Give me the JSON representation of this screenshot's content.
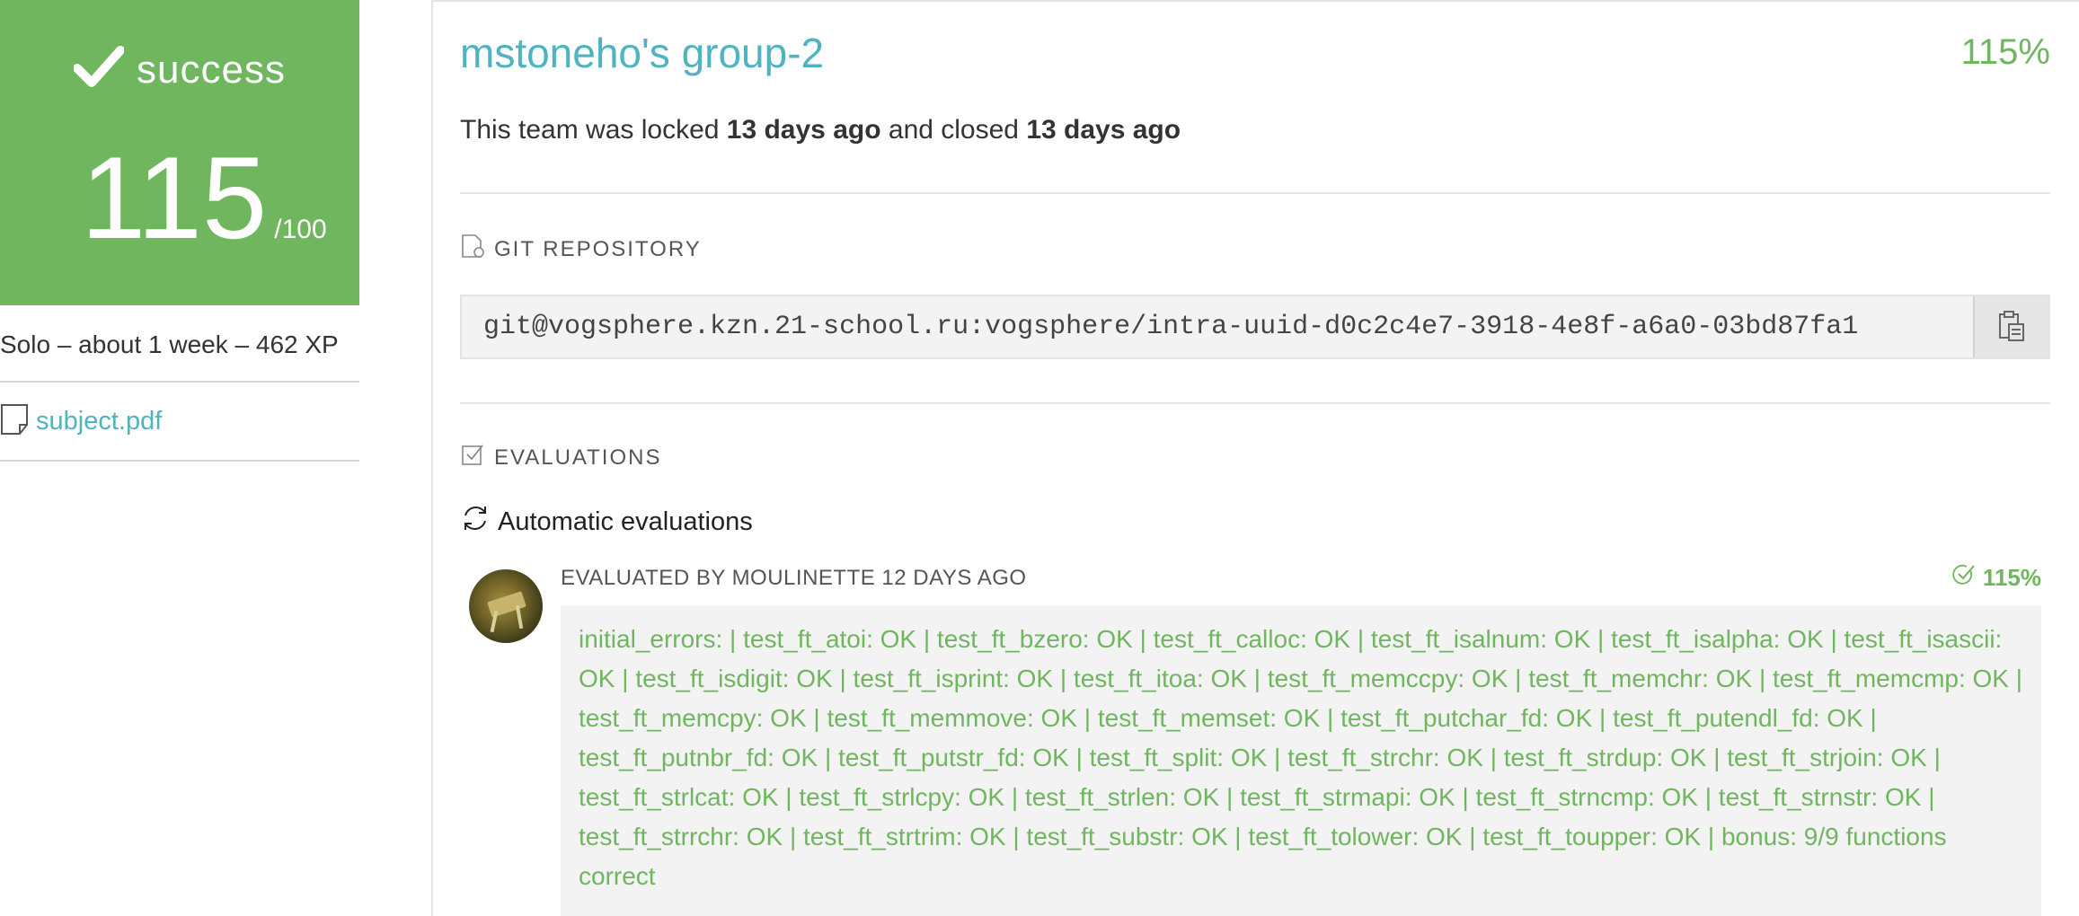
{
  "sidebar": {
    "status": "success",
    "score": "115",
    "score_max": "/100",
    "meta": "Solo – about 1 week – 462 XP",
    "subject_link": "subject.pdf",
    "accent_color": "#6fb65f"
  },
  "team": {
    "title": "mstoneho's group-2",
    "percent": "115%",
    "lock_prefix": "This team was locked ",
    "locked_ago": "13 days ago",
    "lock_middle": " and closed ",
    "closed_ago": "13 days ago"
  },
  "git": {
    "heading": "GIT REPOSITORY",
    "url": "git@vogsphere.kzn.21-school.ru:vogsphere/intra-uuid-d0c2c4e7-3918-4e8f-a6a0-03bd87fa1",
    "copy_icon": "clipboard-icon"
  },
  "evaluations": {
    "heading": "EVALUATIONS",
    "auto_heading": "Automatic evaluations",
    "evaluated_by": "EVALUATED BY MOULINETTE 12 DAYS AGO",
    "score": "115%",
    "result_text": "initial_errors: | test_ft_atoi: OK | test_ft_bzero: OK | test_ft_calloc: OK | test_ft_isalnum: OK | test_ft_isalpha: OK | test_ft_isascii: OK | test_ft_isdigit: OK | test_ft_isprint: OK | test_ft_itoa: OK | test_ft_memccpy: OK | test_ft_memchr: OK | test_ft_memcmp: OK | test_ft_memcpy: OK | test_ft_memmove: OK | test_ft_memset: OK | test_ft_putchar_fd: OK | test_ft_putendl_fd: OK | test_ft_putnbr_fd: OK | test_ft_putstr_fd: OK | test_ft_split: OK | test_ft_strchr: OK | test_ft_strdup: OK | test_ft_strjoin: OK | test_ft_strlcat: OK | test_ft_strlcpy: OK | test_ft_strlen: OK | test_ft_strmapi: OK | test_ft_strncmp: OK | test_ft_strnstr: OK | test_ft_strrchr: OK | test_ft_strtrim: OK | test_ft_substr: OK | test_ft_tolower: OK | test_ft_toupper: OK | bonus: 9/9 functions correct"
  }
}
